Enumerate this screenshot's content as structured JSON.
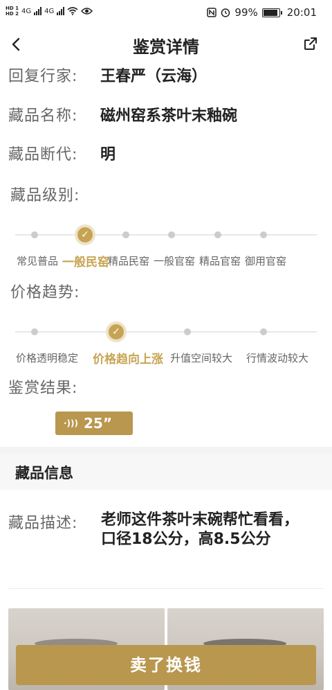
{
  "status_bar": {
    "hd1": "HD 1",
    "hd2": "HD 2",
    "network1": "4G",
    "network2": "4G",
    "battery_percent": "99%",
    "time": "20:01"
  },
  "nav": {
    "title": "鉴赏详情",
    "back_icon": "chevron-left-icon",
    "share_icon": "share-icon"
  },
  "details": {
    "expert_label": "回复行家:",
    "expert_value": "王春严（云海）",
    "name_label": "藏品名称:",
    "name_value": "磁州窑系茶叶末釉碗",
    "dating_label": "藏品断代:",
    "dating_value": "明",
    "grade_label": "藏品级别:",
    "trend_label": "价格趋势:",
    "result_label": "鉴赏结果:"
  },
  "grade_scale": {
    "options": [
      "常见普品",
      "一般民窑",
      "精品民窑",
      "一般官窑",
      "精品官窑",
      "御用官窑"
    ],
    "selected_index": 1
  },
  "trend_scale": {
    "options": [
      "价格透明稳定",
      "价格趋向上涨",
      "升值空间较大",
      "行情波动较大"
    ],
    "selected_index": 1
  },
  "audio": {
    "duration": "25”"
  },
  "info_section": {
    "title": "藏品信息",
    "desc_label": "藏品描述:",
    "desc_value": "老师这件茶叶末碗帮忙看看，口径18公分，高8.5公分"
  },
  "actions": {
    "sell_label": "卖了换钱"
  },
  "colors": {
    "accent": "#b9974e",
    "accent_light": "#c7a453"
  }
}
